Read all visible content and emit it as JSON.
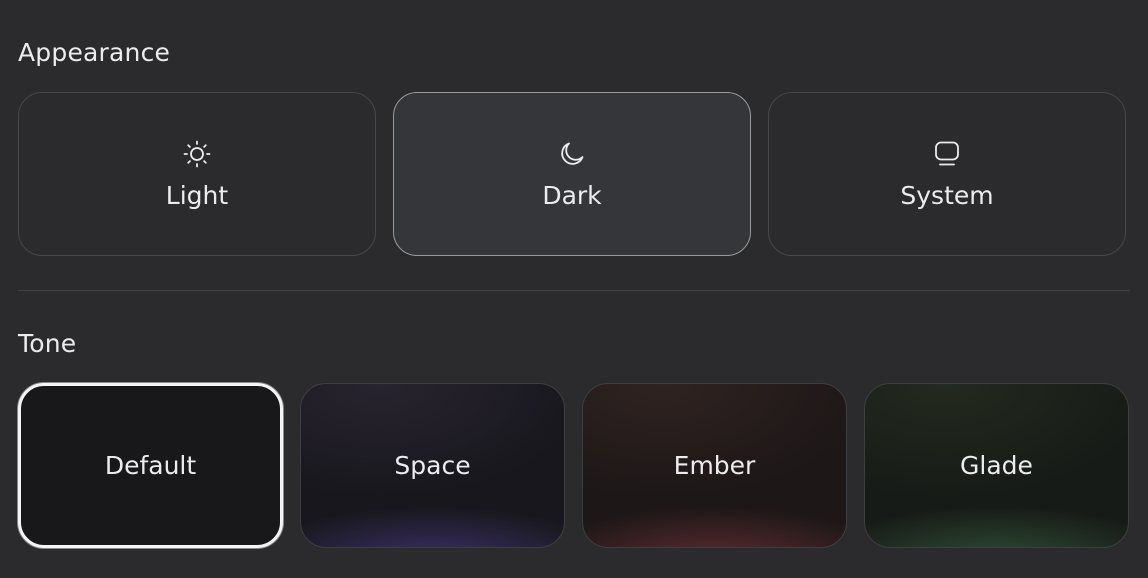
{
  "appearance": {
    "title": "Appearance",
    "modes": [
      {
        "label": "Light",
        "icon": "sun-icon",
        "selected": false
      },
      {
        "label": "Dark",
        "icon": "moon-icon",
        "selected": true
      },
      {
        "label": "System",
        "icon": "monitor-icon",
        "selected": false
      }
    ]
  },
  "tone": {
    "title": "Tone",
    "options": [
      {
        "label": "Default",
        "selected": true
      },
      {
        "label": "Space",
        "selected": false,
        "accent": "#5a46aa"
      },
      {
        "label": "Ember",
        "selected": false,
        "accent": "#963c46"
      },
      {
        "label": "Glade",
        "selected": false,
        "accent": "#467850"
      }
    ]
  },
  "colors": {
    "background": "#2b2b2d",
    "selected_card": "#35363a",
    "text": "#ececee"
  }
}
